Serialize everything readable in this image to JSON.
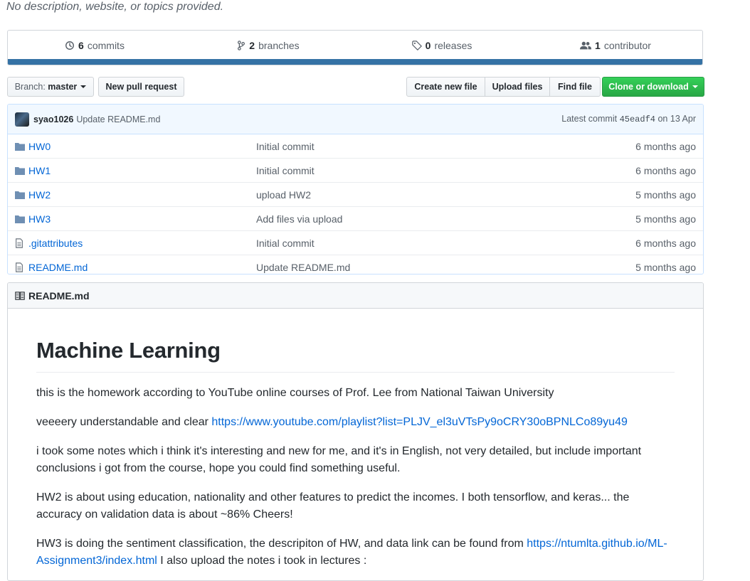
{
  "repo": {
    "description": "No description, website, or topics provided."
  },
  "summary": {
    "commits_count": "6",
    "commits_label": "commits",
    "branches_count": "2",
    "branches_label": "branches",
    "releases_count": "0",
    "releases_label": "releases",
    "contributors_count": "1",
    "contributors_label": "contributor",
    "language_color": "#3572a5"
  },
  "toolbar": {
    "branch_prefix": "Branch:",
    "branch_name": "master",
    "new_pr": "New pull request",
    "create_file": "Create new file",
    "upload_files": "Upload files",
    "find_file": "Find file",
    "clone": "Clone or download"
  },
  "commit": {
    "author": "syao1026",
    "message": "Update README.md",
    "latest_label": "Latest commit",
    "sha": "45eadf4",
    "date": "on 13 Apr"
  },
  "files": [
    {
      "icon": "folder-icon",
      "name": "HW0",
      "message": "Initial commit",
      "age": "6 months ago"
    },
    {
      "icon": "folder-icon",
      "name": "HW1",
      "message": "Initial commit",
      "age": "6 months ago"
    },
    {
      "icon": "folder-icon",
      "name": "HW2",
      "message": "upload HW2",
      "age": "5 months ago"
    },
    {
      "icon": "folder-icon",
      "name": "HW3",
      "message": "Add files via upload",
      "age": "5 months ago"
    },
    {
      "icon": "file-icon",
      "name": ".gitattributes",
      "message": "Initial commit",
      "age": "6 months ago"
    },
    {
      "icon": "file-icon",
      "name": "README.md",
      "message": "Update README.md",
      "age": "5 months ago"
    }
  ],
  "readme": {
    "filename": "README.md",
    "title": "Machine Learning",
    "p1": "this is the homework according to YouTube online courses of Prof. Lee from National Taiwan University",
    "p2_text": "veeeery understandable and clear ",
    "p2_link": "https://www.youtube.com/playlist?list=PLJV_el3uVTsPy9oCRY30oBPNLCo89yu49",
    "p3": "i took some notes which i think it's interesting and new for me, and it's in English, not very detailed, but include important conclusions i got from the course, hope you could find something useful.",
    "p4": "HW2 is about using education, nationality and other features to predict the incomes. I both tensorflow, and keras... the accuracy on validation data is about ~86% Cheers!",
    "p5_text": "HW3 is doing the sentiment classification, the descripiton of HW, and data link can be found from ",
    "p5_link": "https://ntumlta.github.io/ML-Assignment3/index.html",
    "p5_tail": " I also upload the notes i took in lectures :"
  }
}
